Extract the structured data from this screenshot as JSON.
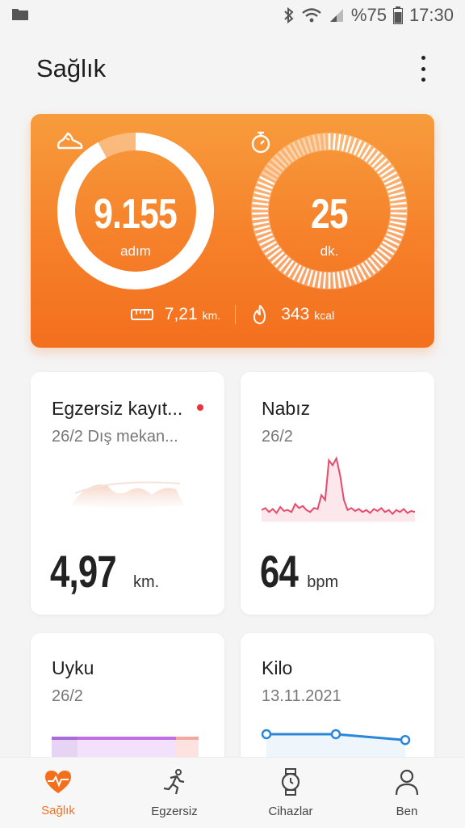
{
  "status_bar": {
    "battery_text": "%75",
    "time": "17:30"
  },
  "header": {
    "title": "Sağlık"
  },
  "activity": {
    "steps_value": "9.155",
    "steps_unit": "adım",
    "steps_progress": 0.92,
    "minutes_value": "25",
    "minutes_unit": "dk.",
    "minutes_progress": 0.83,
    "distance_value": "7,21",
    "distance_unit": "km.",
    "calories_value": "343",
    "calories_unit": "kcal"
  },
  "cards": {
    "exercise": {
      "title": "Egzersiz kayıt...",
      "subtitle": "26/2 Dış mekan...",
      "value": "4,97",
      "unit": "km."
    },
    "heart_rate": {
      "title": "Nabız",
      "subtitle": "26/2",
      "value": "64",
      "unit": "bpm",
      "chart_values": [
        60,
        62,
        58,
        61,
        57,
        63,
        59,
        60,
        58,
        66,
        62,
        64,
        60,
        58,
        62,
        61,
        75,
        70,
        110,
        105,
        112,
        95,
        70,
        60,
        62,
        59,
        61,
        58,
        60,
        57,
        61,
        59,
        62,
        58,
        60,
        56,
        60,
        58,
        61,
        57,
        59,
        58
      ]
    },
    "sleep": {
      "title": "Uyku",
      "subtitle": "26/2"
    },
    "weight": {
      "title": "Kilo",
      "subtitle": "13.11.2021",
      "chart_values": [
        1.0,
        1.0,
        0.8
      ]
    }
  },
  "nav": {
    "items": [
      {
        "label": "Sağlık"
      },
      {
        "label": "Egzersiz"
      },
      {
        "label": "Cihazlar"
      },
      {
        "label": "Ben"
      }
    ]
  },
  "colors": {
    "accent": "#f36f1d",
    "heart_line": "#e84a6a",
    "weight_line": "#2a86d9"
  }
}
